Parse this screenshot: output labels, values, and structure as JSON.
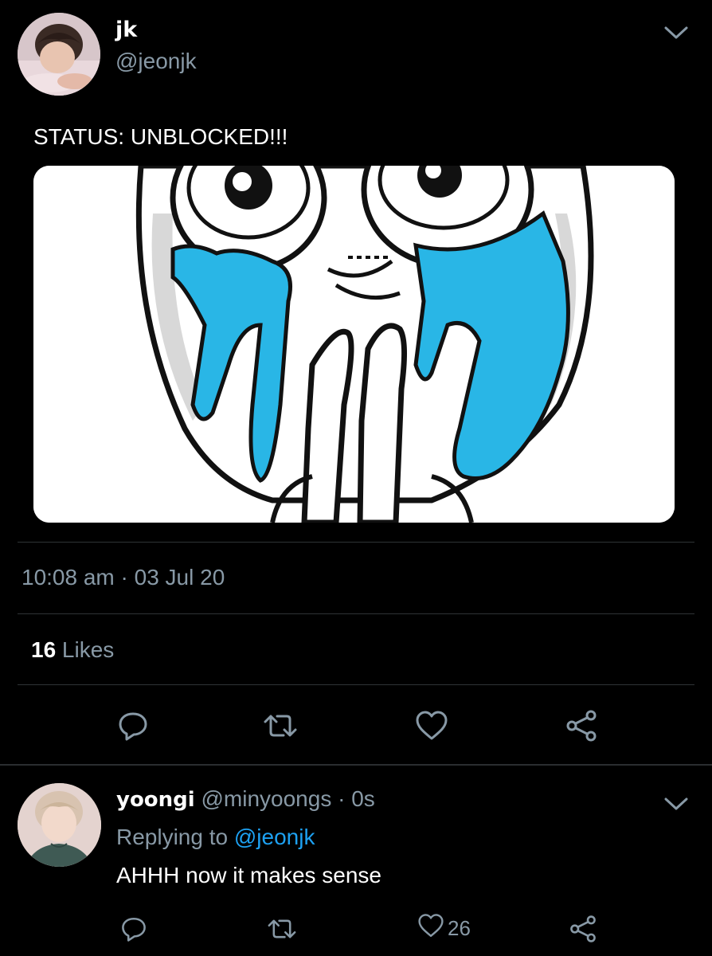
{
  "tweet": {
    "author_name": "jk",
    "author_handle": "@jeonjk",
    "text": "STATUS: UNBLOCKED!!!",
    "timestamp": "10:08 am · 03 Jul 20",
    "likes_count": "16",
    "likes_label": " Likes",
    "actions": [
      "reply-icon",
      "retweet-icon",
      "like-icon",
      "share-icon"
    ]
  },
  "reply": {
    "author_name": "yoongi",
    "author_handle": "@minyoongs",
    "separator": " · ",
    "time": "0s",
    "replying_prefix": "Replying to ",
    "replying_to": "@jeonjk",
    "text": "AHHH now it makes sense",
    "likes_count": "26",
    "actions": [
      "reply-icon",
      "retweet-icon",
      "like-icon",
      "share-icon"
    ]
  },
  "colors": {
    "background": "#000000",
    "secondary_text": "#8899a6",
    "mention": "#1da1f2",
    "tears": "#29b6e6",
    "divider": "#2f3336"
  }
}
